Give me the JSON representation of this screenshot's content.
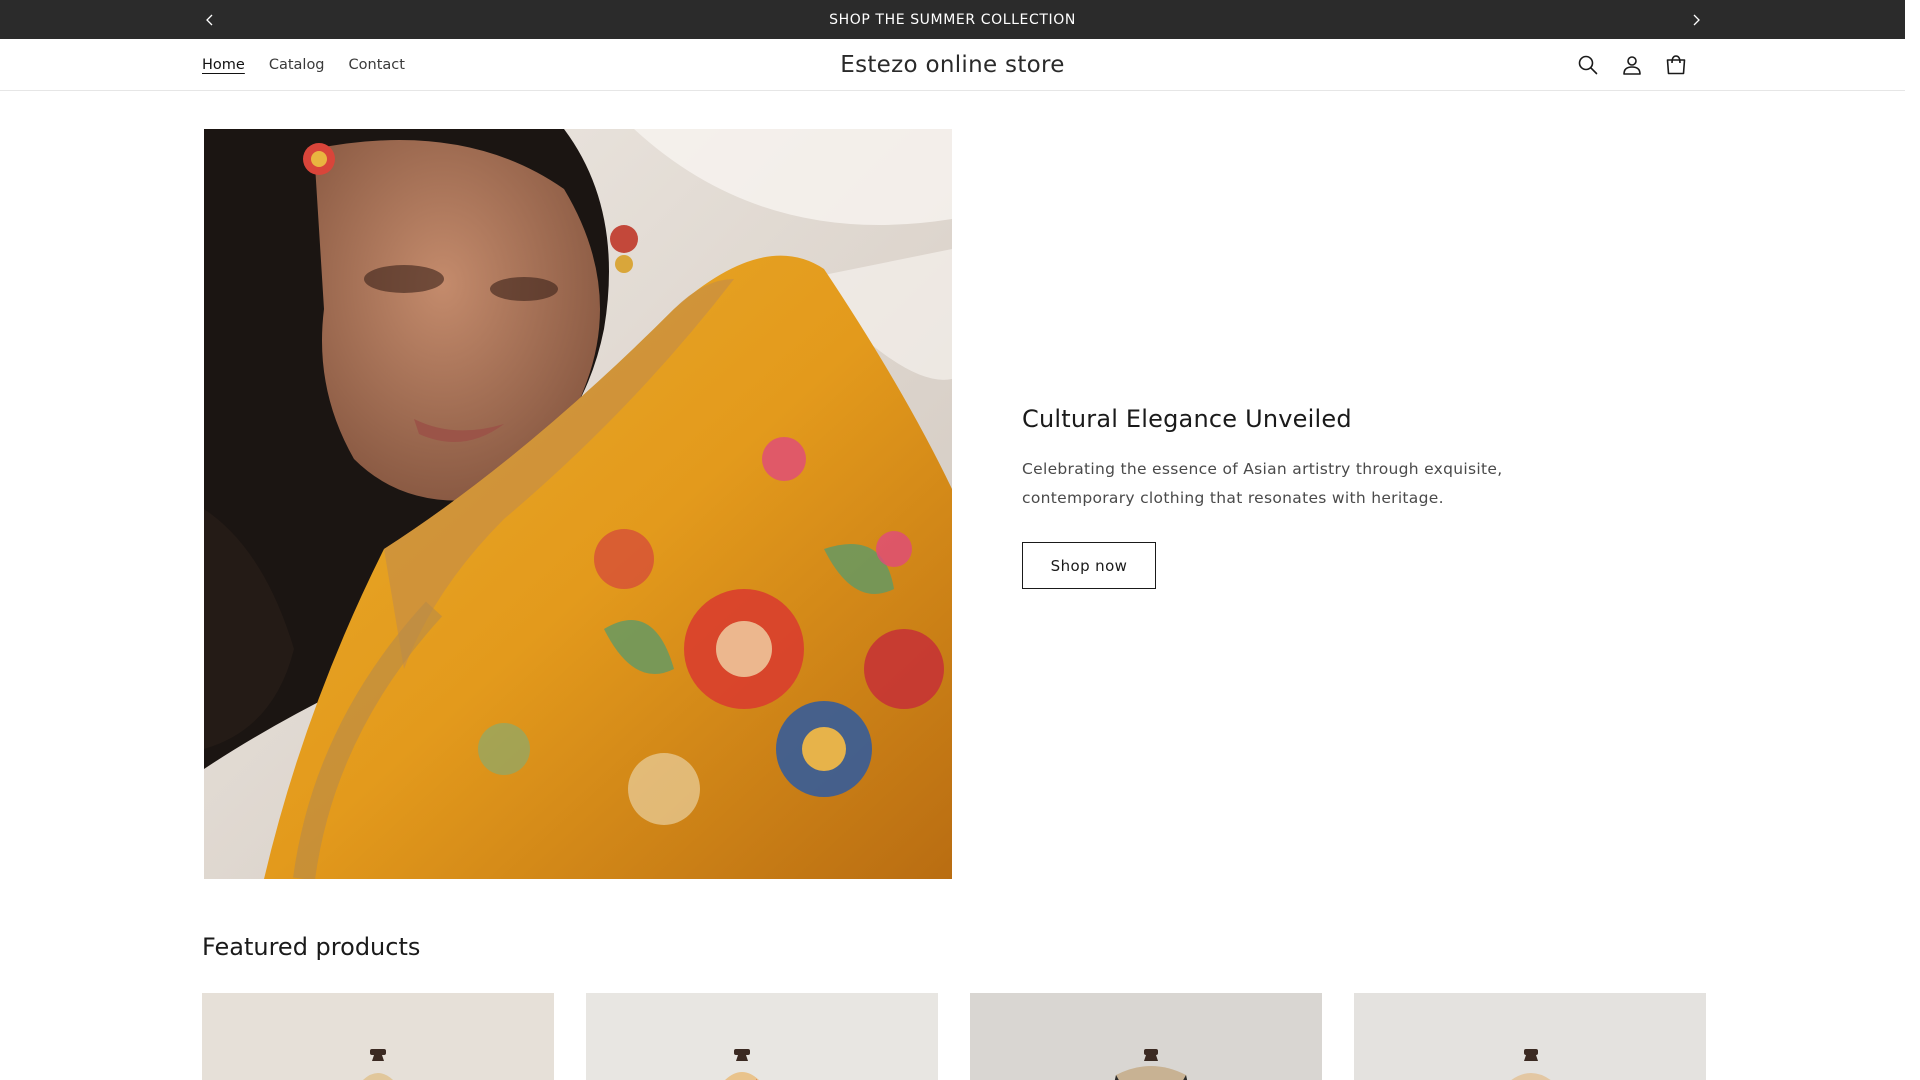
{
  "announcement": {
    "text": "SHOP THE SUMMER COLLECTION"
  },
  "header": {
    "brand": "Estezo online store",
    "nav": [
      {
        "label": "Home",
        "active": true
      },
      {
        "label": "Catalog",
        "active": false
      },
      {
        "label": "Contact",
        "active": false
      }
    ],
    "icons": [
      "search-icon",
      "account-icon",
      "cart-icon"
    ]
  },
  "hero": {
    "title": "Cultural Elegance Unveiled",
    "description": "Celebrating the essence of Asian artistry through exquisite, contemporary clothing that resonates with heritage.",
    "button_label": "Shop now"
  },
  "featured": {
    "title": "Featured products",
    "product_count": 4
  },
  "colors": {
    "announcement_bg": "#2b2b2b",
    "text": "#121212",
    "hero_saree": "#e6a11f"
  }
}
